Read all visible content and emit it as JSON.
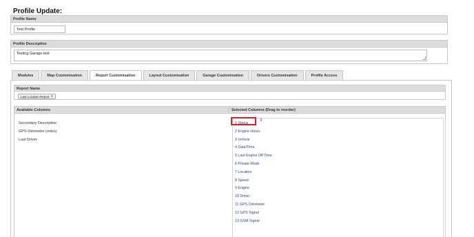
{
  "page": {
    "title": "Profile Update:"
  },
  "profile_name": {
    "header": "Profile Name",
    "value": "Test Profile"
  },
  "profile_description": {
    "header": "Profile Description",
    "value": "Testing Garage test"
  },
  "tabs": [
    {
      "label": "Modules",
      "active": false
    },
    {
      "label": "Map Customisation",
      "active": false
    },
    {
      "label": "Report Customisation",
      "active": true
    },
    {
      "label": "Layout Customisation",
      "active": false
    },
    {
      "label": "Garage Customisation",
      "active": false
    },
    {
      "label": "Drivers Customisation",
      "active": false
    },
    {
      "label": "Profile Access",
      "active": false
    }
  ],
  "report": {
    "header": "Report Name",
    "selected_report": "Last Location Report",
    "select_arrow": "⇕"
  },
  "columns": {
    "available_header": "Available Columns",
    "selected_header": "Selected Columns (Drag to reorder)",
    "available": [
      "Secondary Description",
      "GPS Odometer (miles)",
      "Last Driver"
    ],
    "selected": [
      "1 Status",
      "2 Engine Hours",
      "3 Vehicle",
      "4 Date/Time",
      "5 Last Engine Off Time",
      "6 Private Mode",
      "7 Location",
      "8 Speed",
      "9 Engine",
      "10 Driver",
      "11 GPS Odometer",
      "12 GPS Signal",
      "13 GSM Signal"
    ]
  },
  "annotation": {
    "number": "3",
    "color": "#e02020"
  }
}
